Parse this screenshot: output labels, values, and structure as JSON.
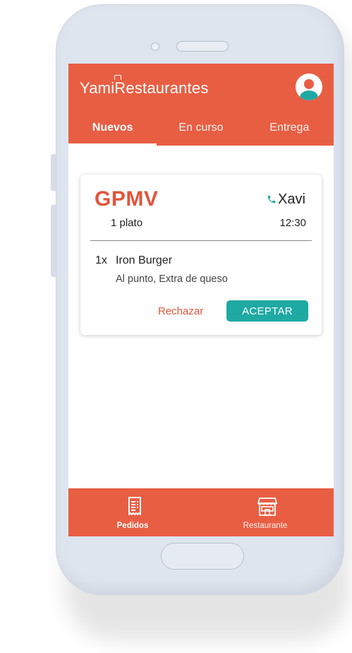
{
  "header": {
    "logo_text": "YamiRestaurantes",
    "avatar_icon": "user-avatar-icon",
    "brand_color": "#e85e43"
  },
  "tabs": [
    {
      "label": "Nuevos",
      "active": true
    },
    {
      "label": "En curso",
      "active": false
    },
    {
      "label": "Entrega",
      "active": false
    }
  ],
  "order": {
    "code": "GPMV",
    "customer_name": "Xavi",
    "phone_icon": "phone-icon",
    "plates": "1 plato",
    "time": "12:30",
    "items": [
      {
        "qty": "1x",
        "name": "Iron Burger",
        "notes": "Al punto, Extra de queso"
      }
    ],
    "reject_label": "Rechazar",
    "accept_label": "ACEPTAR",
    "accent_color": "#1fa9a3"
  },
  "bottom_nav": {
    "items": [
      {
        "label": "Pedidos",
        "icon": "receipt-icon",
        "active": true
      },
      {
        "label": "Restaurante",
        "icon": "storefront-icon",
        "active": false
      }
    ]
  }
}
